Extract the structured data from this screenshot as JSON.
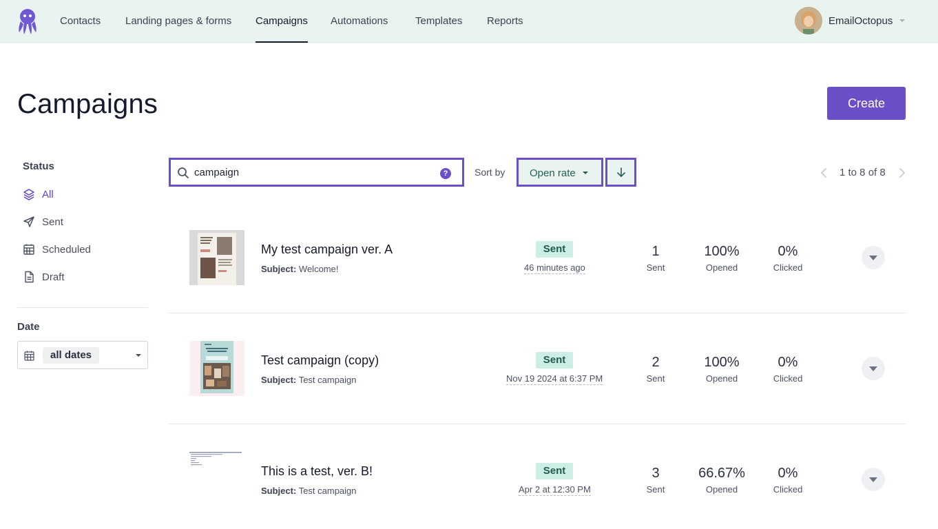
{
  "nav": {
    "items": [
      {
        "label": "Contacts",
        "active": false
      },
      {
        "label": "Landing pages & forms",
        "active": false
      },
      {
        "label": "Campaigns",
        "active": true
      },
      {
        "label": "Automations",
        "active": false
      },
      {
        "label": "Templates",
        "active": false
      },
      {
        "label": "Reports",
        "active": false
      }
    ],
    "account_name": "EmailOctopus"
  },
  "page": {
    "title": "Campaigns",
    "create_label": "Create"
  },
  "sidebar": {
    "status_heading": "Status",
    "items": [
      {
        "label": "All",
        "icon": "layers-icon",
        "active": true
      },
      {
        "label": "Sent",
        "icon": "paper-plane-icon",
        "active": false
      },
      {
        "label": "Scheduled",
        "icon": "calendar-icon",
        "active": false
      },
      {
        "label": "Draft",
        "icon": "document-icon",
        "active": false
      }
    ],
    "date_heading": "Date",
    "date_value": "all dates"
  },
  "toolbar": {
    "search_value": "campaign",
    "help_symbol": "?",
    "sort_by_label": "Sort by",
    "sort_value": "Open rate",
    "sort_direction": "descending",
    "pagination": "1 to 8 of 8"
  },
  "campaigns": [
    {
      "name": "My test campaign ver. A",
      "subject_label": "Subject:",
      "subject": "Welcome!",
      "status": "Sent",
      "date": "46 minutes ago",
      "sent": "1",
      "sent_label": "Sent",
      "opened": "100%",
      "opened_label": "Opened",
      "clicked": "0%",
      "clicked_label": "Clicked"
    },
    {
      "name": "Test campaign (copy)",
      "subject_label": "Subject:",
      "subject": "Test campaign",
      "status": "Sent",
      "date": "Nov 19 2024 at 6:37 PM",
      "sent": "2",
      "sent_label": "Sent",
      "opened": "100%",
      "opened_label": "Opened",
      "clicked": "0%",
      "clicked_label": "Clicked"
    },
    {
      "name": "This is a test, ver. B!",
      "subject_label": "Subject:",
      "subject": "Test campaign",
      "status": "Sent",
      "date": "Apr 2 at 12:30 PM",
      "sent": "3",
      "sent_label": "Sent",
      "opened": "66.67%",
      "opened_label": "Opened",
      "clicked": "0%",
      "clicked_label": "Clicked"
    }
  ],
  "colors": {
    "accent": "#6a4fc8",
    "nav_bg": "#e9f3ef",
    "sent_badge_bg": "#cdeee4",
    "sent_badge_text": "#1e5a4d"
  }
}
